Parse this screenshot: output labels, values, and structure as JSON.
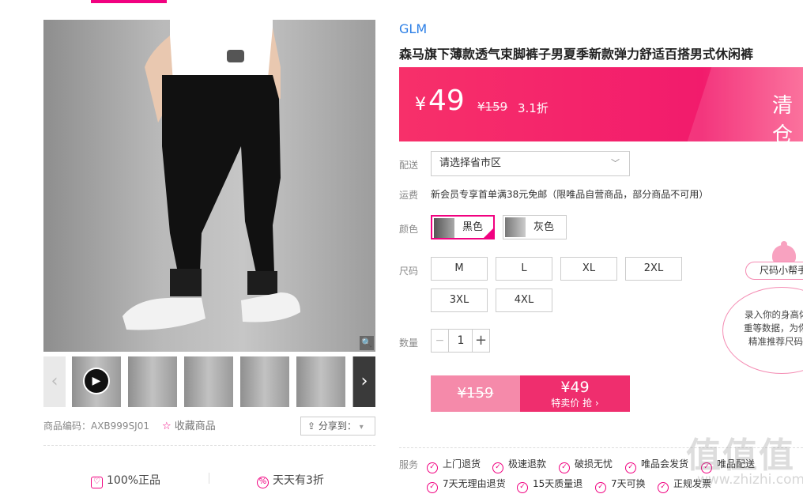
{
  "brand": "GLM",
  "product_title": "森马旗下薄款透气束脚裤子男夏季新款弹力舒适百搭男式休闲裤",
  "price": {
    "currency": "¥",
    "current": "49",
    "original": "¥159",
    "discount": "3.1折",
    "tag": "清仓"
  },
  "delivery": {
    "label": "配送",
    "placeholder": "请选择省市区"
  },
  "shipping": {
    "label": "运费",
    "text": "新会员专享首单满38元免邮（限唯品自营商品，部分商品不可用）"
  },
  "color": {
    "label": "颜色",
    "options": [
      "黑色",
      "灰色"
    ],
    "selected": "黑色"
  },
  "size": {
    "label": "尺码",
    "options": [
      "M",
      "L",
      "XL",
      "2XL",
      "3XL",
      "4XL"
    ]
  },
  "quantity": {
    "label": "数量",
    "value": "1",
    "minus": "−",
    "plus": "+"
  },
  "buy": {
    "old_price": "¥159",
    "price": "¥49",
    "action": "特卖价 抢 ›"
  },
  "services": {
    "label": "服务",
    "items": [
      "上门退货",
      "极速退款",
      "破损无忧",
      "唯品会发货",
      "唯品配送",
      "7天无理由退货",
      "15天质量退",
      "7天可换",
      "正规发票"
    ]
  },
  "gallery": {
    "zoom_icon": "🔍",
    "prev_icon": "‹",
    "next_icon": "›",
    "play_icon": "▶"
  },
  "meta": {
    "sku_label": "商品编码：AXB999SJ01",
    "favorite": "收藏商品",
    "favorite_icon": "☆",
    "share": "分享到：",
    "share_icon": "⇪"
  },
  "promises": [
    {
      "icon": "♡",
      "text": "100%正品"
    },
    {
      "icon": "%",
      "text": "天天有3折"
    }
  ],
  "size_helper": {
    "button": "尺码小帮手",
    "lines": [
      "录入你的身高体",
      "重等数据，为你",
      "精准推荐尺码"
    ]
  },
  "watermark": {
    "main": "值值值",
    "site": "www.zhizhi.com"
  },
  "colors": {
    "accent": "#f10180",
    "price_bar": "#f21b6c",
    "brand": "#2a7ee6"
  }
}
